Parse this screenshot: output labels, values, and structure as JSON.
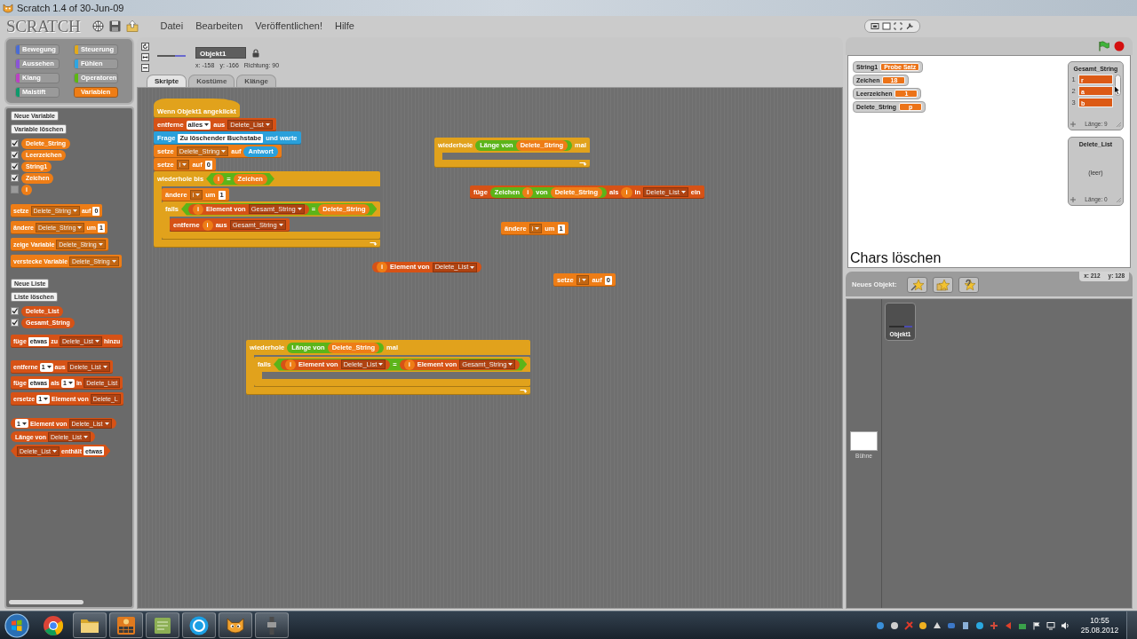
{
  "window": {
    "title": "Scratch 1.4 of 30-Jun-09"
  },
  "menu_bar": {
    "logo": "SCRATCH",
    "menus": [
      "Datei",
      "Bearbeiten",
      "Veröffentlichen!",
      "Hilfe"
    ]
  },
  "categories": [
    {
      "label": "Bewegung",
      "color": "#4a6cd4",
      "selected": false
    },
    {
      "label": "Steuerung",
      "color": "#e1a91a",
      "selected": false
    },
    {
      "label": "Aussehen",
      "color": "#8a55d7",
      "selected": false
    },
    {
      "label": "Fühlen",
      "color": "#2ca5e2",
      "selected": false
    },
    {
      "label": "Klang",
      "color": "#bb42c3",
      "selected": false
    },
    {
      "label": "Operatoren",
      "color": "#5cb712",
      "selected": false
    },
    {
      "label": "Malstift",
      "color": "#0e9a6c",
      "selected": false
    },
    {
      "label": "Variablen",
      "color": "#ee7d16",
      "selected": true
    }
  ],
  "palette": {
    "variable_buttons": [
      "Neue Variable",
      "Variable löschen"
    ],
    "variables": [
      {
        "name": "Delete_String",
        "checked": true
      },
      {
        "name": "Leerzeichen",
        "checked": true
      },
      {
        "name": "String1",
        "checked": true
      },
      {
        "name": "Zeichen",
        "checked": true
      },
      {
        "name": "i",
        "checked": false
      }
    ],
    "variable_blocks": [
      {
        "kind": "stack",
        "color": "#ee7d16",
        "parts": [
          {
            "kind": "text",
            "text": "setze"
          },
          {
            "kind": "menu",
            "text": "Delete_String"
          },
          {
            "kind": "text",
            "text": "auf"
          },
          {
            "kind": "field",
            "text": "0"
          }
        ]
      },
      {
        "kind": "stack",
        "color": "#ee7d16",
        "parts": [
          {
            "kind": "text",
            "text": "ändere"
          },
          {
            "kind": "menu",
            "text": "Delete_String"
          },
          {
            "kind": "text",
            "text": "um"
          },
          {
            "kind": "field",
            "text": "1"
          }
        ]
      },
      {
        "kind": "stack",
        "color": "#ee7d16",
        "parts": [
          {
            "kind": "text",
            "text": "zeige Variable"
          },
          {
            "kind": "menu",
            "text": "Delete_String"
          }
        ]
      },
      {
        "kind": "stack",
        "color": "#ee7d16",
        "parts": [
          {
            "kind": "text",
            "text": "verstecke Variable"
          },
          {
            "kind": "menu",
            "text": "Delete_String"
          }
        ]
      }
    ],
    "list_buttons": [
      "Neue Liste",
      "Liste löschen"
    ],
    "lists": [
      {
        "name": "Delete_List",
        "checked": true
      },
      {
        "name": "Gesamt_String",
        "checked": true
      }
    ],
    "list_blocks": [
      {
        "kind": "stack",
        "color": "#d65216",
        "parts": [
          {
            "kind": "text",
            "text": "füge"
          },
          {
            "kind": "field",
            "text": "etwas"
          },
          {
            "kind": "text",
            "text": "zu"
          },
          {
            "kind": "menu",
            "text": "Delete_List"
          },
          {
            "kind": "text",
            "text": "hinzu"
          }
        ]
      },
      {
        "kind": "stack",
        "color": "#d65216",
        "parts": [
          {
            "kind": "text",
            "text": "entferne"
          },
          {
            "kind": "choice",
            "text": "1"
          },
          {
            "kind": "text",
            "text": "aus"
          },
          {
            "kind": "menu",
            "text": "Delete_List"
          }
        ]
      },
      {
        "kind": "stack",
        "color": "#d65216",
        "parts": [
          {
            "kind": "text",
            "text": "füge"
          },
          {
            "kind": "field",
            "text": "etwas"
          },
          {
            "kind": "text",
            "text": "als"
          },
          {
            "kind": "choice",
            "text": "1"
          },
          {
            "kind": "text",
            "text": "in"
          },
          {
            "kind": "clipped",
            "text": "Delete_List"
          }
        ]
      },
      {
        "kind": "stack",
        "color": "#d65216",
        "parts": [
          {
            "kind": "text",
            "text": "ersetze"
          },
          {
            "kind": "choice",
            "text": "1"
          },
          {
            "kind": "text",
            "text": "Element von"
          },
          {
            "kind": "clipped",
            "text": "Delete_L"
          }
        ]
      },
      {
        "kind": "reporter",
        "color": "#d65216",
        "parts": [
          {
            "kind": "choice",
            "text": "1"
          },
          {
            "kind": "text",
            "text": "Element von"
          },
          {
            "kind": "menu",
            "text": "Delete_List"
          }
        ]
      },
      {
        "kind": "reporter",
        "color": "#d65216",
        "parts": [
          {
            "kind": "text",
            "text": "Länge von"
          },
          {
            "kind": "menu",
            "text": "Delete_List"
          }
        ]
      },
      {
        "kind": "boolean",
        "color": "#d65216",
        "parts": [
          {
            "kind": "menu",
            "text": "Delete_List"
          },
          {
            "kind": "text",
            "text": "enthält"
          },
          {
            "kind": "field",
            "text": "etwas"
          }
        ]
      }
    ]
  },
  "sprite": {
    "name": "Objekt1",
    "x": "x: -158",
    "y": "y: -166",
    "direction": "Richtung: 90"
  },
  "tabs": [
    {
      "label": "Skripte",
      "selected": true
    },
    {
      "label": "Kostüme",
      "selected": false
    },
    {
      "label": "Klänge",
      "selected": false
    }
  ],
  "scripts": [
    {
      "blocks": [
        {
          "kind": "hat",
          "color": "#e1a21c",
          "parts": [
            {
              "kind": "text",
              "text": "Wenn Objekt1 angeklickt"
            }
          ]
        },
        {
          "kind": "stack",
          "color": "#d65216",
          "parts": [
            {
              "kind": "text",
              "text": "entferne"
            },
            {
              "kind": "choice",
              "text": "alles"
            },
            {
              "kind": "text",
              "text": "aus"
            },
            {
              "kind": "menu",
              "text": "Delete_List"
            }
          ]
        },
        {
          "kind": "stack",
          "color": "#2aa0db",
          "parts": [
            {
              "kind": "text",
              "text": "Frage"
            },
            {
              "kind": "field",
              "text": "Zu löschender Buchstabe"
            },
            {
              "kind": "text",
              "text": "und warte"
            }
          ]
        },
        {
          "kind": "stack",
          "color": "#ee7d16",
          "parts": [
            {
              "kind": "text",
              "text": "setze"
            },
            {
              "kind": "menu",
              "text": "Delete_String"
            },
            {
              "kind": "text",
              "text": "auf"
            },
            {
              "kind": "reporter",
              "color": "#2aa0db",
              "text": "Antwort"
            }
          ]
        },
        {
          "kind": "stack",
          "color": "#ee7d16",
          "parts": [
            {
              "kind": "text",
              "text": "setze"
            },
            {
              "kind": "menu",
              "text": "i"
            },
            {
              "kind": "text",
              "text": "auf"
            },
            {
              "kind": "field",
              "text": "0"
            }
          ]
        },
        {
          "kind": "loop",
          "color": "#e1a21c",
          "parts": [
            {
              "kind": "text",
              "text": "wiederhole bis"
            },
            {
              "kind": "boolean",
              "color": "#5cb419",
              "parts": [
                {
                  "kind": "reporter",
                  "color": "#ee7d16",
                  "text": "i"
                },
                {
                  "kind": "text",
                  "text": "="
                },
                {
                  "kind": "reporter",
                  "color": "#ee7d16",
                  "text": "Zeichen"
                }
              ]
            }
          ],
          "inner": [
            {
              "kind": "stack",
              "color": "#ee7d16",
              "parts": [
                {
                  "kind": "text",
                  "text": "ändere"
                },
                {
                  "kind": "menu",
                  "text": "i"
                },
                {
                  "kind": "text",
                  "text": "um"
                },
                {
                  "kind": "field",
                  "text": "1"
                }
              ]
            },
            {
              "kind": "if",
              "color": "#e1a21c",
              "parts": [
                {
                  "kind": "text",
                  "text": "falls"
                },
                {
                  "kind": "boolean",
                  "color": "#5cb419",
                  "parts": [
                    {
                      "kind": "reporter",
                      "color": "#d65216",
                      "parts": [
                        {
                          "kind": "reporter",
                          "color": "#ee7d16",
                          "text": "i"
                        },
                        {
                          "kind": "text",
                          "text": "Element von"
                        },
                        {
                          "kind": "menu",
                          "text": "Gesamt_String"
                        }
                      ]
                    },
                    {
                      "kind": "text",
                      "text": "="
                    },
                    {
                      "kind": "reporter",
                      "color": "#ee7d16",
                      "text": "Delete_String"
                    }
                  ]
                }
              ],
              "inner": [
                {
                  "kind": "stack",
                  "color": "#d65216",
                  "parts": [
                    {
                      "kind": "text",
                      "text": "entferne"
                    },
                    {
                      "kind": "reporter",
                      "color": "#ee7d16",
                      "text": "i"
                    },
                    {
                      "kind": "text",
                      "text": "aus"
                    },
                    {
                      "kind": "menu",
                      "text": "Gesamt_String"
                    }
                  ]
                }
              ]
            }
          ]
        }
      ]
    },
    {
      "blocks": [
        {
          "kind": "loop",
          "color": "#e1a21c",
          "parts": [
            {
              "kind": "text",
              "text": "wiederhole"
            },
            {
              "kind": "reporter",
              "color": "#5cb419",
              "parts": [
                {
                  "kind": "text",
                  "text": "Länge von"
                },
                {
                  "kind": "reporter",
                  "color": "#ee7d16",
                  "text": "Delete_String"
                }
              ]
            },
            {
              "kind": "text",
              "text": "mal"
            }
          ]
        }
      ]
    },
    {
      "blocks": [
        {
          "kind": "stack",
          "color": "#d65216",
          "parts": [
            {
              "kind": "text",
              "text": "füge"
            },
            {
              "kind": "reporter",
              "color": "#5cb419",
              "parts": [
                {
                  "kind": "text",
                  "text": "Zeichen"
                },
                {
                  "kind": "reporter",
                  "color": "#ee7d16",
                  "text": "i"
                },
                {
                  "kind": "text",
                  "text": "von"
                },
                {
                  "kind": "reporter",
                  "color": "#ee7d16",
                  "text": "Delete_String"
                }
              ]
            },
            {
              "kind": "text",
              "text": "als"
            },
            {
              "kind": "reporter",
              "color": "#ee7d16",
              "text": "i"
            },
            {
              "kind": "text",
              "text": "in"
            },
            {
              "kind": "menu",
              "text": "Delete_List"
            },
            {
              "kind": "text",
              "text": "ein"
            }
          ]
        }
      ]
    },
    {
      "blocks": [
        {
          "kind": "stack",
          "color": "#ee7d16",
          "parts": [
            {
              "kind": "text",
              "text": "ändere"
            },
            {
              "kind": "menu",
              "text": "i"
            },
            {
              "kind": "text",
              "text": "um"
            },
            {
              "kind": "field",
              "text": "1"
            }
          ]
        }
      ]
    },
    {
      "blocks": [
        {
          "kind": "reporter",
          "color": "#d65216",
          "parts": [
            {
              "kind": "reporter",
              "color": "#ee7d16",
              "text": "i"
            },
            {
              "kind": "text",
              "text": "Element von"
            },
            {
              "kind": "menu",
              "text": "Delete_List"
            }
          ]
        }
      ]
    },
    {
      "blocks": [
        {
          "kind": "stack",
          "color": "#ee7d16",
          "parts": [
            {
              "kind": "text",
              "text": "setze"
            },
            {
              "kind": "menu",
              "text": "i"
            },
            {
              "kind": "text",
              "text": "auf"
            },
            {
              "kind": "field",
              "text": "0"
            }
          ]
        }
      ]
    },
    {
      "blocks": [
        {
          "kind": "loop",
          "color": "#e1a21c",
          "parts": [
            {
              "kind": "text",
              "text": "wiederhole"
            },
            {
              "kind": "reporter",
              "color": "#5cb419",
              "parts": [
                {
                  "kind": "text",
                  "text": "Länge von"
                },
                {
                  "kind": "reporter",
                  "color": "#ee7d16",
                  "text": "Delete_String"
                }
              ]
            },
            {
              "kind": "text",
              "text": "mal"
            }
          ],
          "inner": [
            {
              "kind": "if",
              "color": "#e1a21c",
              "parts": [
                {
                  "kind": "text",
                  "text": "falls"
                },
                {
                  "kind": "boolean",
                  "color": "#5cb419",
                  "parts": [
                    {
                      "kind": "reporter",
                      "color": "#d65216",
                      "parts": [
                        {
                          "kind": "reporter",
                          "color": "#ee7d16",
                          "text": "i"
                        },
                        {
                          "kind": "text",
                          "text": "Element von"
                        },
                        {
                          "kind": "menu",
                          "text": "Delete_List"
                        }
                      ]
                    },
                    {
                      "kind": "text",
                      "text": "="
                    },
                    {
                      "kind": "reporter",
                      "color": "#d65216",
                      "parts": [
                        {
                          "kind": "reporter",
                          "color": "#ee7d16",
                          "text": "i"
                        },
                        {
                          "kind": "text",
                          "text": "Element von"
                        },
                        {
                          "kind": "menu",
                          "text": "Gesamt_String"
                        }
                      ]
                    }
                  ]
                }
              ]
            }
          ]
        }
      ]
    }
  ],
  "stage": {
    "caption": "Chars löschen",
    "monitors": [
      {
        "label": "String1",
        "value": "Probe Satz"
      },
      {
        "label": "Zeichen",
        "value": "18"
      },
      {
        "label": "Leerzeichen",
        "value": "1"
      },
      {
        "label": "Delete_String",
        "value": "p"
      }
    ],
    "list_monitors": [
      {
        "title": "Gesamt_String",
        "items": [
          {
            "index": "1",
            "value": "r"
          },
          {
            "index": "2",
            "value": "a"
          },
          {
            "index": "3",
            "value": "b"
          }
        ],
        "length": "Länge: 9"
      },
      {
        "title": "Delete_List",
        "empty": "(leer)",
        "length": "Länge: 0"
      }
    ],
    "mouse_x": "x: 212",
    "mouse_y": "y: 128"
  },
  "sprite_pane": {
    "new_sprite_label": "Neues Objekt:",
    "sprites": [
      {
        "name": "Objekt1",
        "selected": true
      }
    ],
    "stage_label": "Bühne"
  },
  "taskbar": {
    "apps": [
      {
        "kind": "browser",
        "running": false
      },
      {
        "kind": "folder",
        "running": true
      },
      {
        "kind": "grid",
        "running": true
      },
      {
        "kind": "notes",
        "running": true
      },
      {
        "kind": "chat",
        "running": true
      },
      {
        "kind": "cat",
        "running": true
      },
      {
        "kind": "device",
        "running": true
      }
    ],
    "time": "10:55",
    "date": "25.08.2012"
  }
}
